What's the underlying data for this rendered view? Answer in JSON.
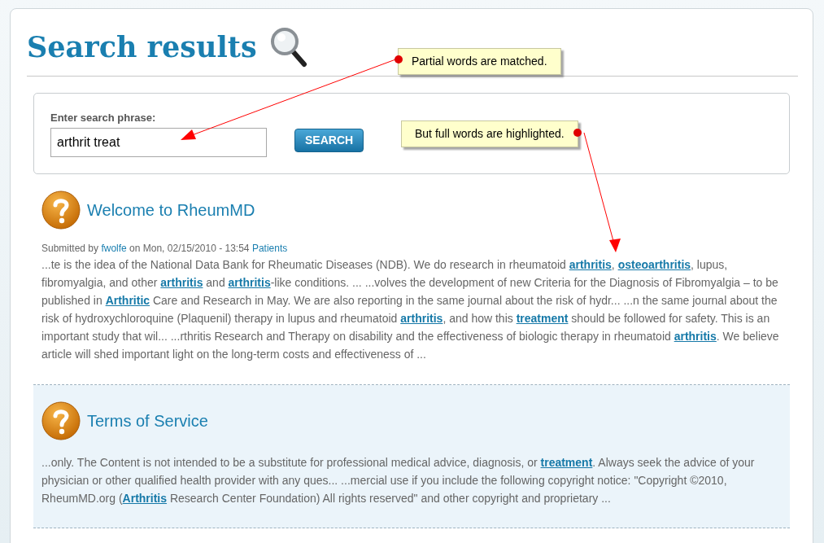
{
  "page_title": "Search results",
  "search": {
    "label": "Enter search phrase:",
    "value": "arthrit treat",
    "button": "SEARCH"
  },
  "callouts": [
    {
      "text": "Partial words are matched.",
      "kind": "dot_left"
    },
    {
      "text": "But full words are highlighted.",
      "kind": "dot_right"
    }
  ],
  "results": [
    {
      "title": "Welcome to RheumMD",
      "shaded": false,
      "meta": {
        "prefix": "Submitted by",
        "author": "fwolfe",
        "date": "on Mon, 02/15/2010 - 13:54",
        "category": "Patients"
      },
      "snippet": [
        {
          "text": "...te is the idea of the National Data Bank for Rheumatic Diseases (NDB). We do research in rheumatoid ",
          "highlight": false
        },
        {
          "text": "arthritis",
          "highlight": true
        },
        {
          "text": ", ",
          "highlight": false
        },
        {
          "text": "osteoarthritis",
          "highlight": true
        },
        {
          "text": ", lupus, fibromyalgia, and other ",
          "highlight": false
        },
        {
          "text": "arthritis",
          "highlight": true
        },
        {
          "text": " and ",
          "highlight": false
        },
        {
          "text": "arthritis",
          "highlight": true
        },
        {
          "text": "-like conditions. ... ...volves the development of new Criteria for the Diagnosis of Fibromyalgia – to be published in ",
          "highlight": false
        },
        {
          "text": "Arthritic",
          "highlight": true
        },
        {
          "text": " Care and Research in May. We are also reporting in the same journal about the risk of hydr... ...n the same journal about the risk of hydroxychloroquine (Plaquenil) therapy in lupus and rheumatoid ",
          "highlight": false
        },
        {
          "text": "arthritis",
          "highlight": true
        },
        {
          "text": ", and how this ",
          "highlight": false
        },
        {
          "text": "treatment",
          "highlight": true
        },
        {
          "text": " should be followed for safety. This is an important study that wil... ...rthritis Research and Therapy on disability and the effectiveness of biologic therapy in rheumatoid ",
          "highlight": false
        },
        {
          "text": "arthritis",
          "highlight": true
        },
        {
          "text": ". We believe article will shed important light on the long-term costs and effectiveness of ...",
          "highlight": false
        }
      ]
    },
    {
      "title": "Terms of Service",
      "shaded": true,
      "snippet": [
        {
          "text": "...only. The Content is not intended to be a substitute for professional medical advice, diagnosis, or ",
          "highlight": false
        },
        {
          "text": "treatment",
          "highlight": true
        },
        {
          "text": ". Always seek the advice of your physician or other qualified health provider with any ques... ...mercial use if you include the following copyright notice: \"Copyright ©2010, RheumMD.org (",
          "highlight": false
        },
        {
          "text": "Arthritis",
          "highlight": true
        },
        {
          "text": " Research Center Foundation) All rights reserved\" and other copyright and proprietary ...",
          "highlight": false
        }
      ]
    }
  ]
}
